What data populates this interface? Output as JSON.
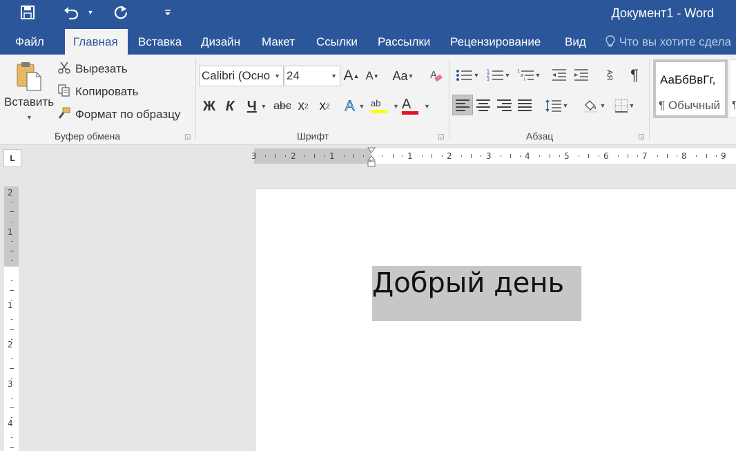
{
  "window": {
    "title": "Документ1 - Word"
  },
  "quick_access": {
    "save_icon": "save-icon",
    "undo_icon": "undo-icon",
    "redo_icon": "redo-icon",
    "customize_icon": "chevron-down-icon"
  },
  "tabs": [
    {
      "label": "Файл"
    },
    {
      "label": "Главная",
      "active": true
    },
    {
      "label": "Вставка"
    },
    {
      "label": "Дизайн"
    },
    {
      "label": "Макет"
    },
    {
      "label": "Ссылки"
    },
    {
      "label": "Рассылки"
    },
    {
      "label": "Рецензирование"
    },
    {
      "label": "Вид"
    }
  ],
  "tell_me": {
    "placeholder": "Что вы хотите сдела"
  },
  "clipboard": {
    "group_label": "Буфер обмена",
    "paste_label": "Вставить",
    "cut_label": "Вырезать",
    "copy_label": "Копировать",
    "format_painter_label": "Формат по образцу"
  },
  "font": {
    "group_label": "Шрифт",
    "font_name": "Calibri (Осно",
    "font_size": "24",
    "grow_label": "A",
    "shrink_label": "A",
    "change_case_label": "Aa",
    "bold_label": "Ж",
    "italic_label": "К",
    "underline_label": "Ч",
    "strike_label": "abc",
    "subscript_label": "x",
    "superscript_label": "x",
    "text_effects_label": "A",
    "highlight_label": "ab",
    "font_color_label": "A",
    "highlight_color": "#ffff00",
    "font_color": "#e81123"
  },
  "paragraph": {
    "group_label": "Абзац",
    "pilcrow_label": "¶",
    "sort_label": "АЯ"
  },
  "styles": {
    "preview_text": "АаБбВвГг,",
    "style_name": "¶ Обычный",
    "next_partial": "¶"
  },
  "ruler": {
    "top_numbers_left": [
      "3",
      "2",
      "1"
    ],
    "top_numbers_right": [
      "1",
      "2",
      "3",
      "4",
      "5",
      "6",
      "7",
      "8",
      "9"
    ],
    "left_numbers": [
      "2",
      "1",
      "1",
      "2",
      "3",
      "4"
    ],
    "tab_selector": "L"
  },
  "document": {
    "text": "Добрый день"
  },
  "colors": {
    "brand": "#2b579a",
    "ribbon": "#f3f3f3",
    "selection": "#c8c6c6"
  }
}
